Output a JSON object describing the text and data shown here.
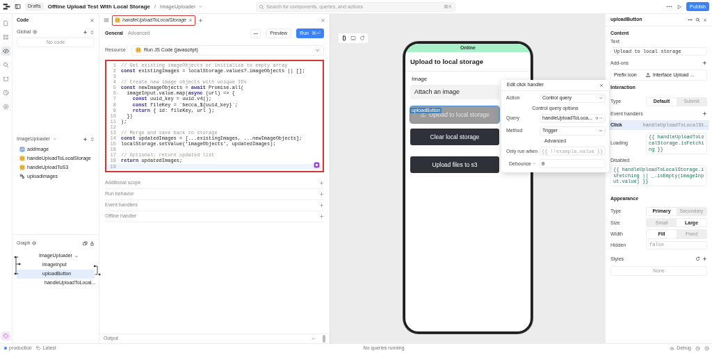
{
  "topbar": {
    "drafts": "Drafts",
    "app_title": "Offline Upload Test With Local Storage",
    "separator": "/",
    "page": "ImageUploader",
    "search": {
      "placeholder": "Search for components, queries, and actions",
      "shortcut": "⌘K"
    },
    "publish": "Publish"
  },
  "rail": [
    {
      "kind": "file",
      "selected": false
    },
    {
      "kind": "components",
      "selected": false
    },
    {
      "kind": "code",
      "selected": true
    },
    {
      "kind": "search",
      "selected": false
    },
    {
      "kind": "state",
      "selected": false
    },
    {
      "kind": "history",
      "selected": false
    },
    {
      "kind": "settings",
      "selected": false
    }
  ],
  "code_panel": {
    "title": "Code",
    "global": {
      "label": "Global",
      "empty": "No code"
    },
    "page": {
      "label": "ImageUploader",
      "items": [
        {
          "kind": "resource",
          "name": "addImage"
        },
        {
          "kind": "script",
          "name": "handleUploadToLocalStorage"
        },
        {
          "kind": "script",
          "name": "handleUploadToS3"
        },
        {
          "kind": "workflow",
          "name": "uploadImages"
        }
      ]
    }
  },
  "graph": {
    "title": "Graph",
    "tree": [
      {
        "name": "ImageUploader",
        "expanded": true,
        "selected": false,
        "children": [
          {
            "name": "imageInput",
            "kind": "component",
            "selected": false
          },
          {
            "name": "uploadButton",
            "kind": "component",
            "selected": true
          },
          {
            "name": "handleUploadToLocal...",
            "kind": "script",
            "selected": false
          }
        ]
      }
    ]
  },
  "editor": {
    "tab": {
      "label": "handleUploadToLocalStorage",
      "selected": true
    },
    "subtabs": [
      {
        "label": "General",
        "selected": true
      },
      {
        "label": "Advanced",
        "selected": false
      }
    ],
    "preview": "Preview",
    "run": "Run",
    "run_shortcut": "⌘⏎",
    "resource_label": "Resource",
    "resource": "Run JS Code (javascript)",
    "lines": [
      {
        "number": "1",
        "kind": "comment",
        "text": "// Get existing imageObjects or initialize to empty array",
        "foldable": false,
        "active": false
      },
      {
        "number": "2",
        "kind": "code",
        "text": "**const** existingImages = localStorage.values?.imageObjects || [];",
        "foldable": false,
        "active": false
      },
      {
        "number": "3",
        "kind": "blank",
        "foldable": false,
        "active": false
      },
      {
        "number": "4",
        "kind": "comment",
        "text": "// Create new image objects with unique IDs",
        "foldable": false,
        "active": false
      },
      {
        "number": "5",
        "kind": "code",
        "text": "**const** newImageObjects = **await** Promise.all(",
        "foldable": false,
        "active": false
      },
      {
        "number": "6",
        "kind": "code",
        "text": "  imageInput.value.map(**async** (url) => {",
        "foldable": true,
        "active": false
      },
      {
        "number": "7",
        "kind": "code",
        "text": "    **const** uuid_key = uuid.v4();",
        "foldable": false,
        "active": false
      },
      {
        "number": "8",
        "kind": "code",
        "text": "    **const** fileKey = `becca_${uuid_key}`;",
        "foldable": false,
        "active": false
      },
      {
        "number": "9",
        "kind": "code",
        "text": "    **return** { id: fileKey, url };",
        "foldable": false,
        "active": false
      },
      {
        "number": "10",
        "kind": "code",
        "text": "  })",
        "foldable": false,
        "active": false
      },
      {
        "number": "11",
        "kind": "code",
        "text": ");",
        "foldable": false,
        "active": false
      },
      {
        "number": "12",
        "kind": "blank",
        "foldable": false,
        "active": false
      },
      {
        "number": "13",
        "kind": "comment",
        "text": "// Merge and save back to storage",
        "foldable": false,
        "active": false
      },
      {
        "number": "14",
        "kind": "code",
        "text": "**const** updatedImages = [...existingImages, ...newImageObjects];",
        "foldable": false,
        "active": false
      },
      {
        "number": "15",
        "kind": "code",
        "text": "localStorage.setValue('imageObjects', updatedImages);",
        "foldable": false,
        "active": false
      },
      {
        "number": "16",
        "kind": "blank",
        "foldable": false,
        "active": false
      },
      {
        "number": "17",
        "kind": "comment",
        "text": "// Optional: return updated list",
        "foldable": false,
        "active": false
      },
      {
        "number": "18",
        "kind": "code",
        "text": "**return** updatedImages;",
        "foldable": false,
        "active": false
      },
      {
        "number": "19",
        "kind": "blank",
        "foldable": false,
        "active": true
      }
    ],
    "sections": [
      "Additional scope",
      "Run behavior",
      "Event handlers",
      "Offline handler"
    ],
    "output": "Output"
  },
  "canvas": {
    "devices": [
      {
        "kind": "mobile",
        "selected": true
      },
      {
        "kind": "desktop",
        "selected": false
      }
    ],
    "phone": {
      "status": "Online",
      "title": "Upload to local storage",
      "image_label": "Image",
      "image_button": "Attach an image",
      "selected_tag": "uploadButton",
      "buttons": [
        {
          "label": "Upload to local storage",
          "kind": "upload",
          "disabled": true,
          "selected": true
        },
        {
          "label": "Clear local storage",
          "kind": "plain",
          "disabled": false,
          "selected": false
        },
        {
          "label": "Upload files to s3",
          "kind": "plain",
          "disabled": false,
          "selected": false
        }
      ]
    }
  },
  "handler_popup": {
    "title": "Edit click handler",
    "action_label": "Action",
    "action": "Control query",
    "options_heading": "Control query options",
    "query_label": "Query",
    "query": "handleUploadToLoca...",
    "method_label": "Method",
    "method": "Trigger",
    "advanced_heading": "Advanced",
    "only_run_label": "Only run when",
    "only_run_placeholder": "{{ !!example.value }}",
    "debounce_label": "Debounce",
    "debounce": "0"
  },
  "inspector": {
    "title": "uploadButton",
    "content": {
      "heading": "Content",
      "text_label": "Text",
      "text_value": "Upload to local storage",
      "addons_label": "Add-ons",
      "prefix_label": "Prefix icon",
      "prefix_value": "Interface Upload ..."
    },
    "interaction": {
      "heading": "Interaction",
      "type_label": "Type",
      "type_options": [
        {
          "label": "Default",
          "selected": true
        },
        {
          "label": "Submit",
          "selected": false
        }
      ],
      "handlers_label": "Event handlers",
      "handler": {
        "event": "Click",
        "query": "handleUploadToLocalSt…",
        "selected": true
      },
      "loading_label": "Loading",
      "loading_value": "{{ handleUploadToLocalStorage.isFetching }}",
      "disabled_label": "Disabled",
      "disabled_value": "{{ handleUploadToLocalStorage.isFetching || _.isEmpty(imageInput.value) }}"
    },
    "appearance": {
      "heading": "Appearance",
      "rows": [
        {
          "label": "Type",
          "kind": "segmented",
          "options": [
            {
              "label": "Primary",
              "selected": true
            },
            {
              "label": "Secondary",
              "selected": false
            }
          ]
        },
        {
          "label": "Size",
          "kind": "segmented",
          "options": [
            {
              "label": "Small",
              "selected": false
            },
            {
              "label": "Large",
              "selected": true
            }
          ]
        },
        {
          "label": "Width",
          "kind": "segmented",
          "options": [
            {
              "label": "Fill",
              "selected": true
            },
            {
              "label": "Fixed",
              "selected": false
            }
          ]
        },
        {
          "label": "Hidden",
          "kind": "field",
          "value": "false"
        }
      ],
      "styles_label": "Styles",
      "styles_value": "None"
    }
  },
  "status_bar": {
    "environment": "production",
    "version": "Latest",
    "queries": "No queries running",
    "debug": "Debug"
  }
}
